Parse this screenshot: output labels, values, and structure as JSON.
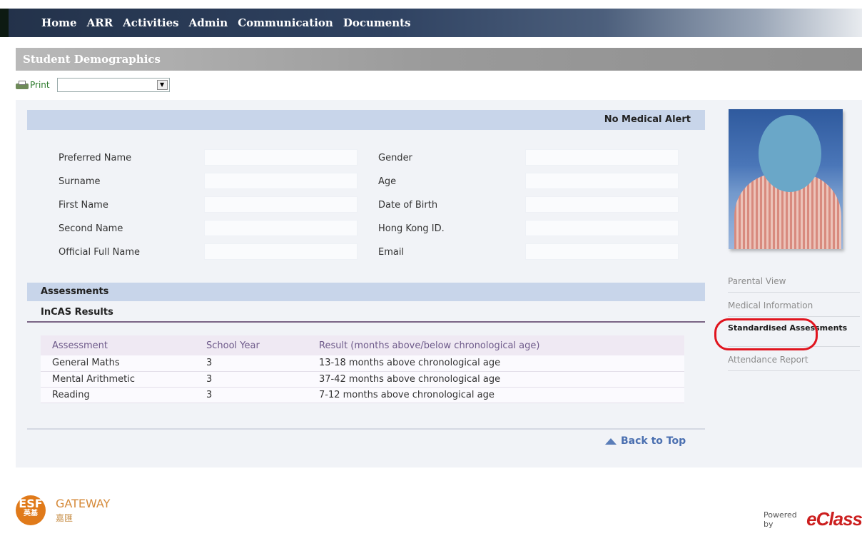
{
  "nav": {
    "items": [
      "Home",
      "ARR",
      "Activities",
      "Admin",
      "Communication",
      "Documents"
    ]
  },
  "page": {
    "title": "Student Demographics"
  },
  "toolbar": {
    "print_label": "Print",
    "select_value": ""
  },
  "alert": {
    "text": "No Medical Alert"
  },
  "fields": {
    "left": [
      {
        "label": "Preferred Name",
        "value": ""
      },
      {
        "label": "Surname",
        "value": ""
      },
      {
        "label": "First Name",
        "value": ""
      },
      {
        "label": "Second Name",
        "value": ""
      },
      {
        "label": "Official Full Name",
        "value": ""
      }
    ],
    "right": [
      {
        "label": "Gender",
        "value": ""
      },
      {
        "label": "Age",
        "value": ""
      },
      {
        "label": "Date of Birth",
        "value": ""
      },
      {
        "label": "Hong Kong ID.",
        "value": ""
      },
      {
        "label": "Email",
        "value": ""
      }
    ]
  },
  "assessments": {
    "section_title": "Assessments",
    "subsection_title": "InCAS Results",
    "columns": [
      "Assessment",
      "School Year",
      "Result (months above/below chronological age)"
    ],
    "rows": [
      [
        "General Maths",
        "3",
        "13-18 months above chronological age"
      ],
      [
        "Mental Arithmetic",
        "3",
        "37-42 months above chronological age"
      ],
      [
        "Reading",
        "3",
        "7-12 months above chronological age"
      ]
    ]
  },
  "back_to_top": "Back to Top",
  "sidenav": {
    "items": [
      {
        "label": "Parental View"
      },
      {
        "label": "Medical Information"
      },
      {
        "label": "Standardised Assessments",
        "active": true
      },
      {
        "label": "Attendance Report"
      }
    ]
  },
  "footer": {
    "logo_primary": "ESF",
    "logo_primary_cn": "英基",
    "logo_name": "GATEWAY",
    "logo_name_cn": "嘉匯",
    "powered_by": "Powered by",
    "brand": "eClass"
  },
  "colors": {
    "nav_bg": "#23324a",
    "title_bar": "#9a9a9a",
    "section_bar": "#c8d5ea",
    "highlight": "#e0141e",
    "link": "#4a6fb0"
  }
}
